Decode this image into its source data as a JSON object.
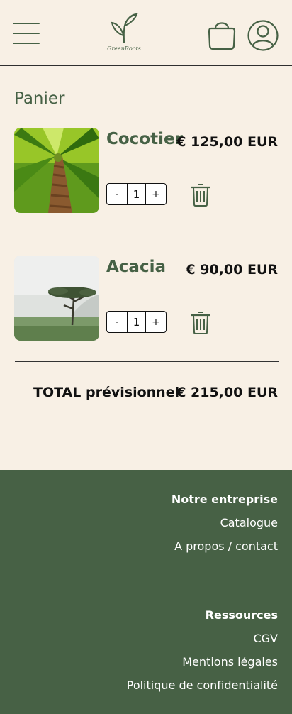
{
  "header": {
    "logo_text": "GreenRoots"
  },
  "cart": {
    "title": "Panier",
    "items": [
      {
        "name": "Cocotier",
        "price": "€ 125,00 EUR",
        "quantity": "1",
        "minus": "-",
        "plus": "+"
      },
      {
        "name": "Acacia",
        "price": "€ 90,00 EUR",
        "quantity": "1",
        "minus": "-",
        "plus": "+"
      }
    ],
    "total_label": "TOTAL prévisionnel",
    "total_value": "€ 215,00 EUR"
  },
  "footer": {
    "company": {
      "heading": "Notre entreprise",
      "links": [
        "Catalogue",
        "A propos / contact"
      ]
    },
    "resources": {
      "heading": "Ressources",
      "links": [
        "CGV",
        "Mentions légales",
        "Politique de confidentialité"
      ]
    }
  },
  "colors": {
    "brand_green": "#466145",
    "background": "#f8f0e5",
    "footer_bg": "#476145"
  },
  "icons": {
    "menu": "hamburger-menu-icon",
    "logo": "sprout-logo-icon",
    "cart": "shopping-bag-icon",
    "account": "user-account-icon",
    "delete": "trash-icon"
  }
}
